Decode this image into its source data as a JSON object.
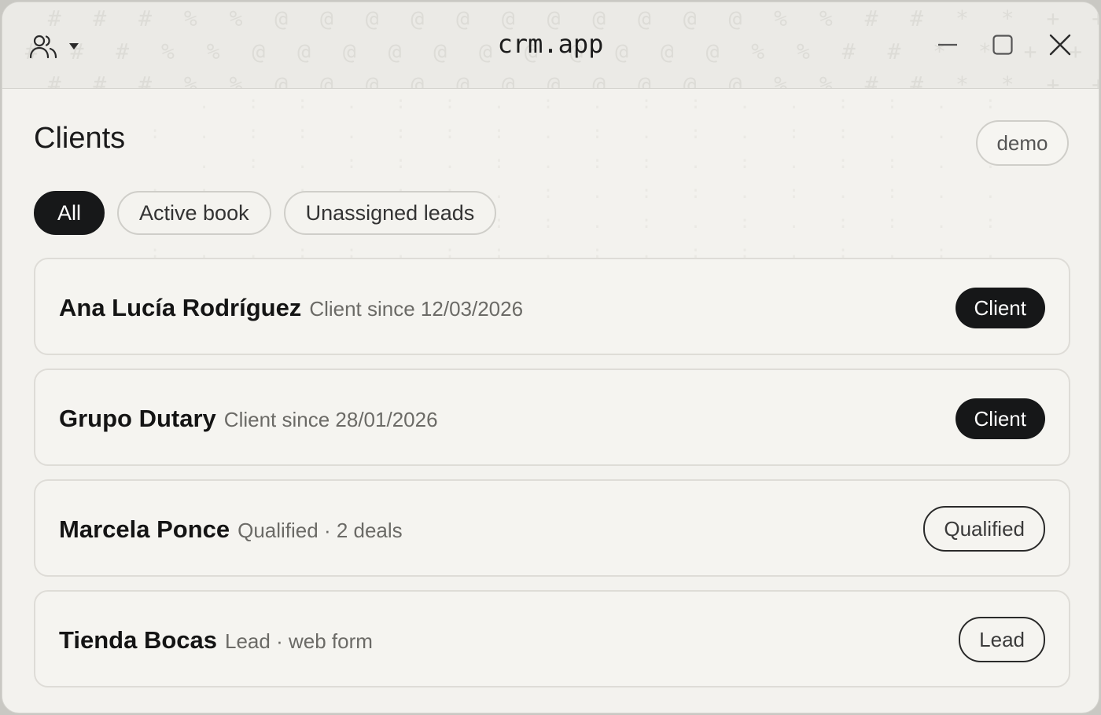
{
  "window": {
    "title": "crm.app"
  },
  "icons": {
    "user_menu": "users-icon",
    "user_menu_caret": "caret-down-icon",
    "minimize": "minimize-icon",
    "maximize": "maximize-icon",
    "close": "close-icon"
  },
  "header": {
    "title": "Clients",
    "badge": "demo"
  },
  "filters": [
    {
      "label": "All",
      "active": true
    },
    {
      "label": "Active book",
      "active": false
    },
    {
      "label": "Unassigned leads",
      "active": false
    }
  ],
  "clients": [
    {
      "name": "Ana Lucía Rodríguez",
      "meta": "Client since 12/03/2026",
      "status": "Client",
      "style": "filled"
    },
    {
      "name": "Grupo Dutary",
      "meta": "Client since 28/01/2026",
      "status": "Client",
      "style": "filled"
    },
    {
      "name": "Marcela Ponce",
      "meta": "Qualified · 2 deals",
      "status": "Qualified",
      "style": "outline"
    },
    {
      "name": "Tienda Bocas",
      "meta": "Lead · web form",
      "status": "Lead",
      "style": "outline"
    }
  ],
  "colors": {
    "accent": "#171819",
    "background": "#f3f2ee",
    "border": "#dedcd7"
  }
}
